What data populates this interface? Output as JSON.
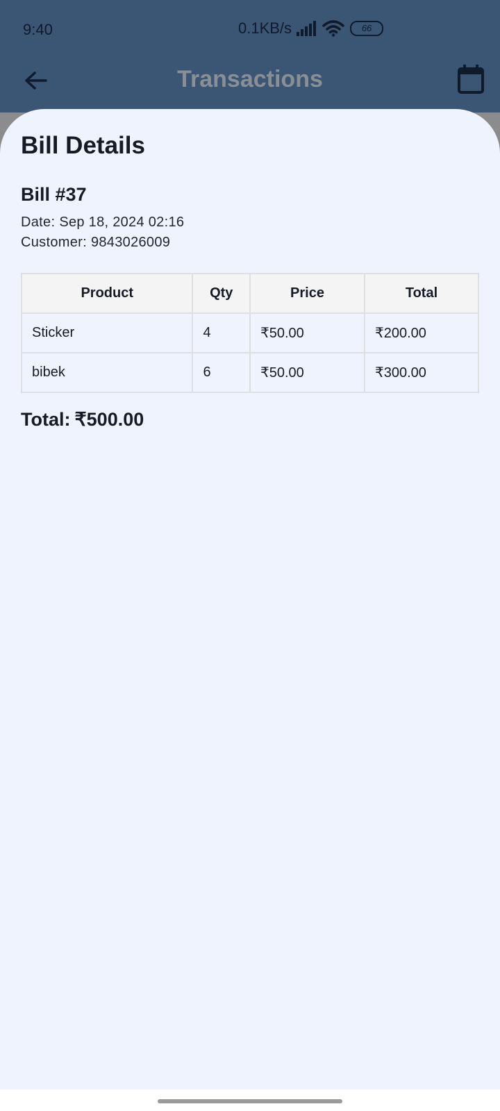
{
  "status_bar": {
    "time": "9:40",
    "network_speed": "0.1KB/s",
    "battery_level": "66"
  },
  "app_bar": {
    "title": "Transactions",
    "back_icon": "arrow-left-icon",
    "calendar_icon": "calendar-icon"
  },
  "sheet": {
    "title": "Bill Details",
    "bill_number": "Bill #37",
    "date_label": "Date:",
    "date_value": "Sep 18, 2024 02:16",
    "customer_label": "Customer:",
    "customer_value": "9843026009",
    "table": {
      "headers": [
        "Product",
        "Qty",
        "Price",
        "Total"
      ],
      "rows": [
        [
          "Sticker",
          "4",
          "₹50.00",
          "₹200.00"
        ],
        [
          "bibek",
          "6",
          "₹50.00",
          "₹300.00"
        ]
      ]
    },
    "total_label": "Total:",
    "total_value": "₹500.00"
  },
  "colors": {
    "app_bar_bg": "#3b5575",
    "sheet_bg": "#eff3fe",
    "title_text": "#8a8f96",
    "table_border": "#dedfe2"
  }
}
